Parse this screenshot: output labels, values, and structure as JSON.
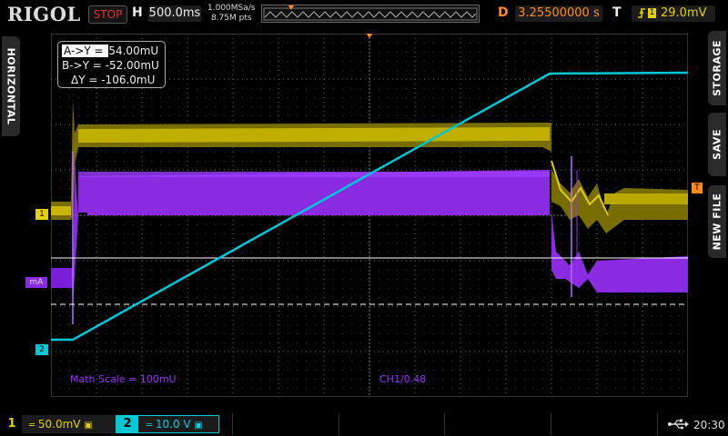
{
  "brand": "RIGOL",
  "status": "STOP",
  "horizontal": {
    "label": "H",
    "timebase": "500.0ms",
    "sample_rate": "1.000MSa/s",
    "memory_points": "8.75M pts"
  },
  "delay": {
    "label": "D",
    "value": "3.25500000 s"
  },
  "trigger": {
    "label": "T",
    "source": "1",
    "level": "29.0mV"
  },
  "side_left": {
    "horizontal_label": "HORIZONTAL"
  },
  "side_right": {
    "storage_label": "STORAGE",
    "save_label": "SAVE",
    "new_file_label": "NEW FILE"
  },
  "cursors": {
    "ay": "A->Y = ",
    "ay_value": "54.00mU",
    "by": "B->Y = -52.00mU",
    "dy": "ΔY = -106.0mU"
  },
  "channel_markers": {
    "ch1": "1",
    "ch2": "2",
    "math": "mA",
    "trigger_level": "T"
  },
  "math": {
    "scale_text": "Math Scale = 100mU",
    "expression": "CH1/0.48"
  },
  "channels": [
    {
      "id": "1",
      "scale": "50.0mV",
      "color": "#e5d000"
    },
    {
      "id": "2",
      "scale": "10.0 V",
      "color": "#00c8d6"
    }
  ],
  "math_color": "#9b30ff",
  "clock": "20:30"
}
